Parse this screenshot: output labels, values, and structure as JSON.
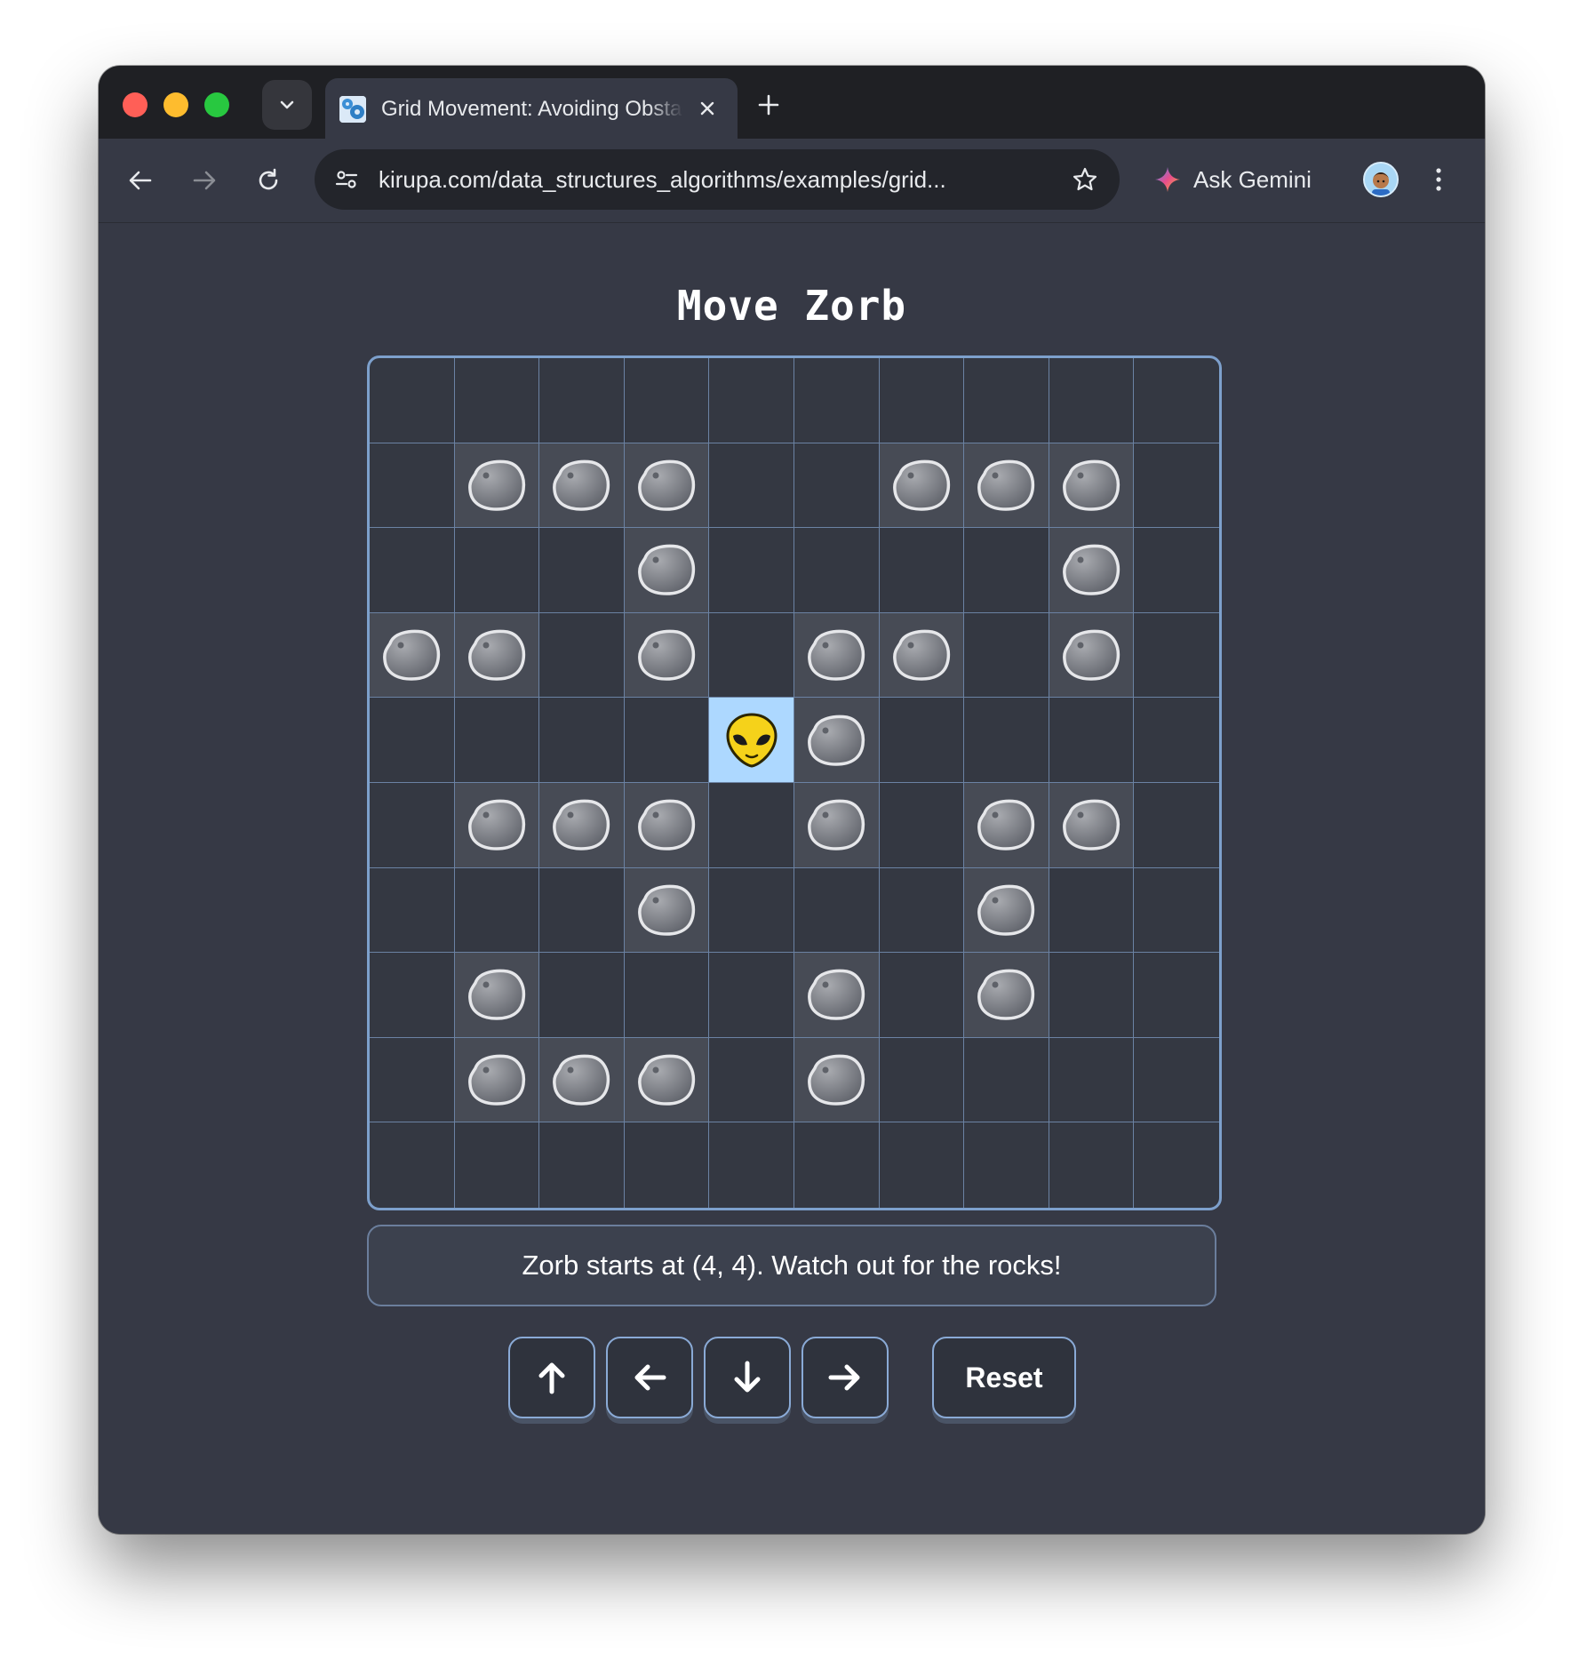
{
  "browser": {
    "tab_title": "Grid Movement: Avoiding Obstacles",
    "url": "kirupa.com/data_structures_algorithms/examples/grid...",
    "gemini_label": "Ask Gemini"
  },
  "game": {
    "title": "Move Zorb",
    "status": "Zorb starts at (4, 4). Watch out for the rocks!",
    "reset_label": "Reset",
    "controls": [
      "up-arrow-icon",
      "left-arrow-icon",
      "down-arrow-icon",
      "right-arrow-icon"
    ],
    "grid_size": 10,
    "zorb_position": [
      4,
      4
    ],
    "rocks": [
      [
        1,
        1
      ],
      [
        2,
        1
      ],
      [
        3,
        1
      ],
      [
        6,
        1
      ],
      [
        7,
        1
      ],
      [
        8,
        1
      ],
      [
        3,
        2
      ],
      [
        8,
        2
      ],
      [
        0,
        3
      ],
      [
        1,
        3
      ],
      [
        3,
        3
      ],
      [
        5,
        3
      ],
      [
        6,
        3
      ],
      [
        8,
        3
      ],
      [
        5,
        4
      ],
      [
        1,
        5
      ],
      [
        2,
        5
      ],
      [
        3,
        5
      ],
      [
        5,
        5
      ],
      [
        7,
        5
      ],
      [
        8,
        5
      ],
      [
        3,
        6
      ],
      [
        7,
        6
      ],
      [
        1,
        7
      ],
      [
        5,
        7
      ],
      [
        7,
        7
      ],
      [
        1,
        8
      ],
      [
        2,
        8
      ],
      [
        3,
        8
      ],
      [
        5,
        8
      ]
    ],
    "colors": {
      "grid_line": "#6b82a3",
      "zorb_cell": "#add8ff",
      "rock_cell": "#474b55"
    }
  }
}
